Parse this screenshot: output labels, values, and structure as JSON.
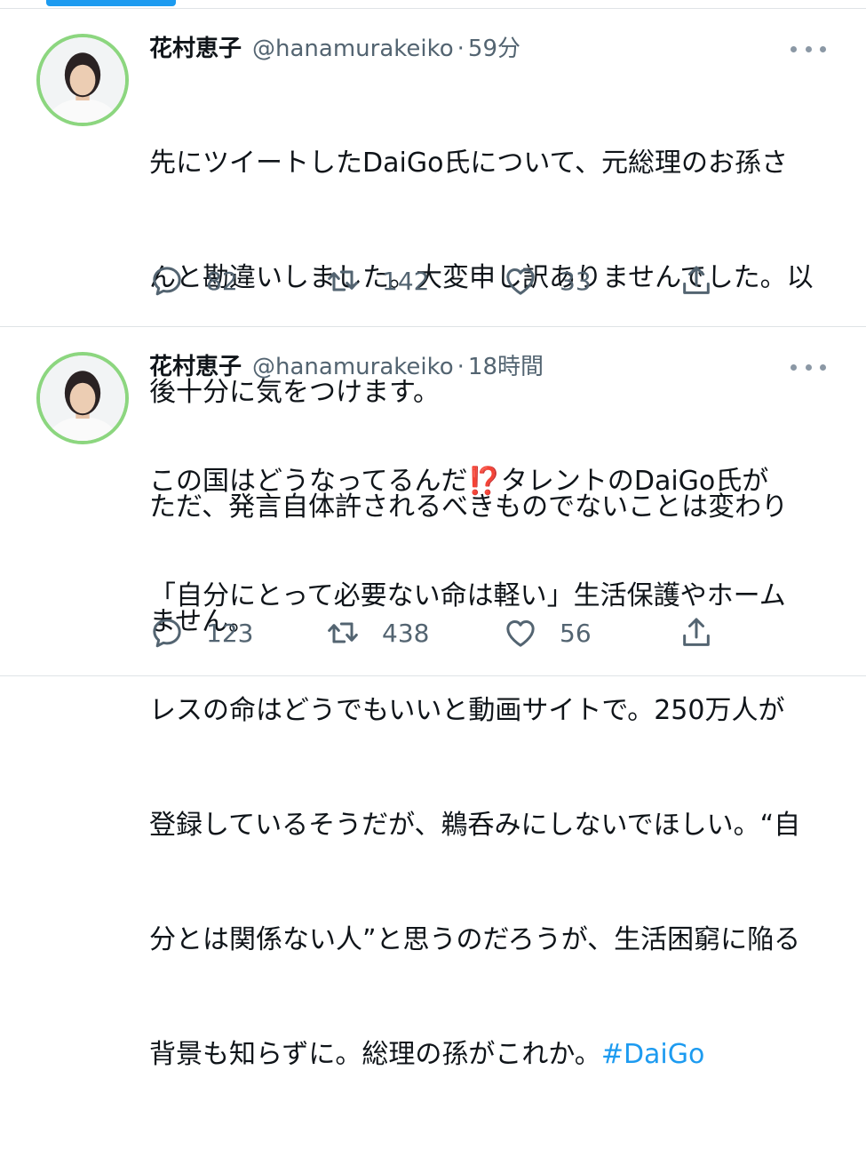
{
  "tweets": [
    {
      "display_name": "花村恵子",
      "handle": "@hanamurakeiko",
      "separator": "·",
      "time": "59分",
      "lines": [
        "先にツイートしたDaiGo氏について、元総理のお孫さ",
        "んと勘違いしました。大変申し訳ありませんでした。以",
        "後十分に気をつけます。",
        "ただ、発言自体許されるべきものでないことは変わり",
        "ません。"
      ],
      "replies": "82",
      "retweets": "142",
      "likes": "33"
    },
    {
      "display_name": "花村恵子",
      "handle": "@hanamurakeiko",
      "separator": "·",
      "time": "18時間",
      "line1_before": "この国はどうなってるんだ",
      "line1_emoji": "⁉️",
      "line1_after": "タレントのDaiGo氏が",
      "lines": [
        "「自分にとって必要ない命は軽い」生活保護やホーム",
        "レスの命はどうでもいいと動画サイトで。250万人が",
        "登録しているそうだが、鵜呑みにしないでほしい。“自",
        "分とは関係ない人”と思うのだろうが、生活困窮に陥る"
      ],
      "last_line_text": "背景も知らずに。総理の孫がこれか。",
      "hashtag": "#DaiGo",
      "replies": "123",
      "retweets": "438",
      "likes": "56"
    }
  ],
  "colors": {
    "accent": "#1d9bf0",
    "muted": "#536471",
    "avatar_ring": "#8cd67f",
    "divider": "#dfe3e6"
  },
  "icons": [
    "reply-icon",
    "retweet-icon",
    "like-icon",
    "share-icon",
    "more-icon"
  ]
}
